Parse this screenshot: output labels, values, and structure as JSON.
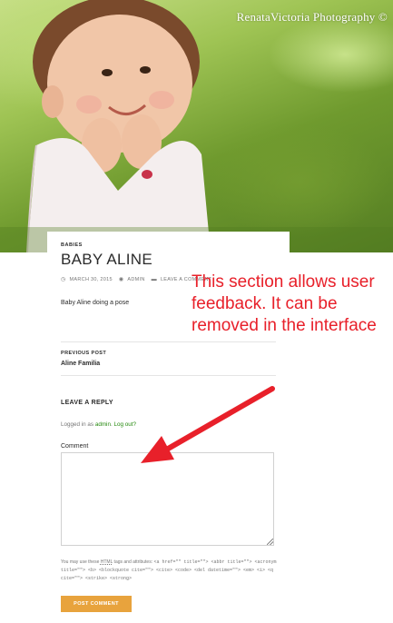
{
  "hero": {
    "watermark": "RenataVictoria Photography ©"
  },
  "post": {
    "category": "BABIES",
    "title": "BABY ALINE",
    "meta": {
      "date": "MARCH 30, 2015",
      "author": "ADMIN",
      "comment_link": "LEAVE A COMMENT"
    },
    "body": "Baby Aline doing a pose"
  },
  "nav": {
    "previous_label": "PREVIOUS POST",
    "previous_title": "Aline Familia"
  },
  "reply": {
    "heading": "LEAVE A REPLY",
    "logged_prefix": "Logged in as ",
    "user": "admin",
    "logout": "Log out?",
    "comment_label": "Comment",
    "allowed_prefix": "You may use these ",
    "allowed_abbr": "HTML",
    "allowed_mid": " tags and attributes: ",
    "allowed_tags": "<a href=\"\" title=\"\"> <abbr title=\"\"> <acronym title=\"\"> <b> <blockquote cite=\"\"> <cite> <code> <del datetime=\"\"> <em> <i> <q cite=\"\"> <strike> <strong>",
    "submit_label": "POST COMMENT"
  },
  "annotation": {
    "text": "This section allows user feedback.  It can be removed in the interface",
    "color": "#e8202a"
  },
  "colors": {
    "accent_button": "#e8a33d",
    "link_green": "#24890d"
  }
}
